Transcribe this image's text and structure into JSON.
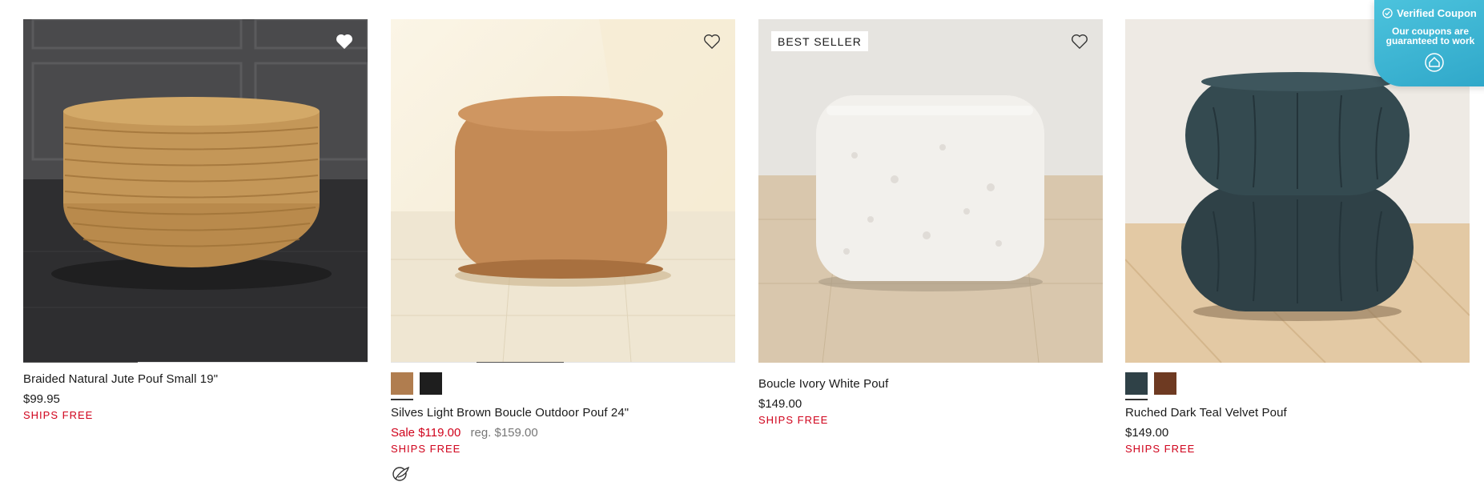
{
  "products": [
    {
      "name": "Braided Natural Jute Pouf Small 19\"",
      "price": "$99.95",
      "shipping": "SHIPS FREE",
      "image_icon": "jute-pouf-image",
      "favorite_icon": "heart-icon"
    },
    {
      "name": "Silves Light Brown Boucle Outdoor Pouf 24\"",
      "sale_price": "Sale $119.00",
      "regular_price": "reg. $159.00",
      "shipping": "SHIPS FREE",
      "swatches": [
        {
          "name": "light-brown",
          "color": "#b07d4f"
        },
        {
          "name": "black",
          "color": "#1e1e1e"
        }
      ],
      "feature_icon": "leaf-icon",
      "favorite_icon": "heart-outline-icon"
    },
    {
      "badge": "BEST SELLER",
      "name": "Boucle Ivory White Pouf",
      "price": "$149.00",
      "shipping": "SHIPS FREE",
      "favorite_icon": "heart-outline-icon"
    },
    {
      "name": "Ruched Dark Teal Velvet Pouf",
      "price": "$149.00",
      "shipping": "SHIPS FREE",
      "swatches": [
        {
          "name": "dark-teal",
          "color": "#2f4147"
        },
        {
          "name": "rust",
          "color": "#6e3a22"
        }
      ]
    }
  ],
  "coupon_widget": {
    "title": "Verified Coupon",
    "subtitle": "Our coupons are guaranteed to work",
    "icon": "coupon-logo-icon"
  },
  "colors": {
    "sale_red": "#d0021b",
    "coupon_blue": "#3ab4d4"
  }
}
